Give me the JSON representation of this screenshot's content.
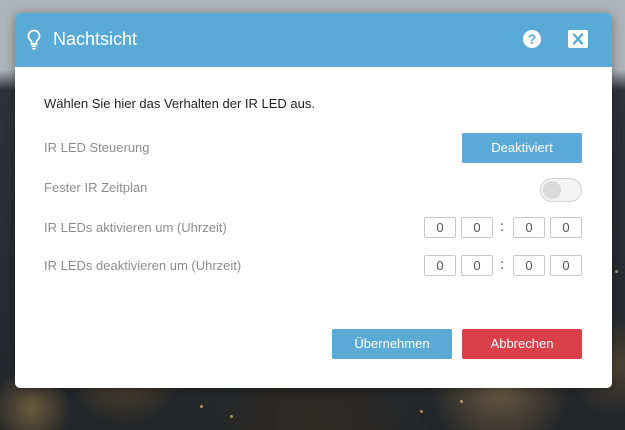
{
  "dialog": {
    "title": "Nachtsicht",
    "help_icon": "help-icon",
    "help_glyph": "?",
    "close_icon": "close-icon"
  },
  "intro": "Wählen Sie hier das Verhalten der IR LED aus.",
  "settings": {
    "ir_led_control": {
      "label": "IR LED Steuerung",
      "button": "Deaktiviert"
    },
    "fixed_schedule": {
      "label": "Fester IR Zeitplan",
      "enabled": false
    },
    "activate_time": {
      "label": "IR LEDs aktivieren um (Uhrzeit)",
      "digits": [
        "0",
        "0",
        "0",
        "0"
      ],
      "separator": ":"
    },
    "deactivate_time": {
      "label": "IR LEDs deaktivieren um (Uhrzeit)",
      "digits": [
        "0",
        "0",
        "0",
        "0"
      ],
      "separator": ":"
    }
  },
  "footer": {
    "apply": "Übernehmen",
    "cancel": "Abbrechen"
  },
  "colors": {
    "header": "#5aaad6",
    "primary_button": "#5aaad6",
    "danger_button": "#d9404a"
  }
}
